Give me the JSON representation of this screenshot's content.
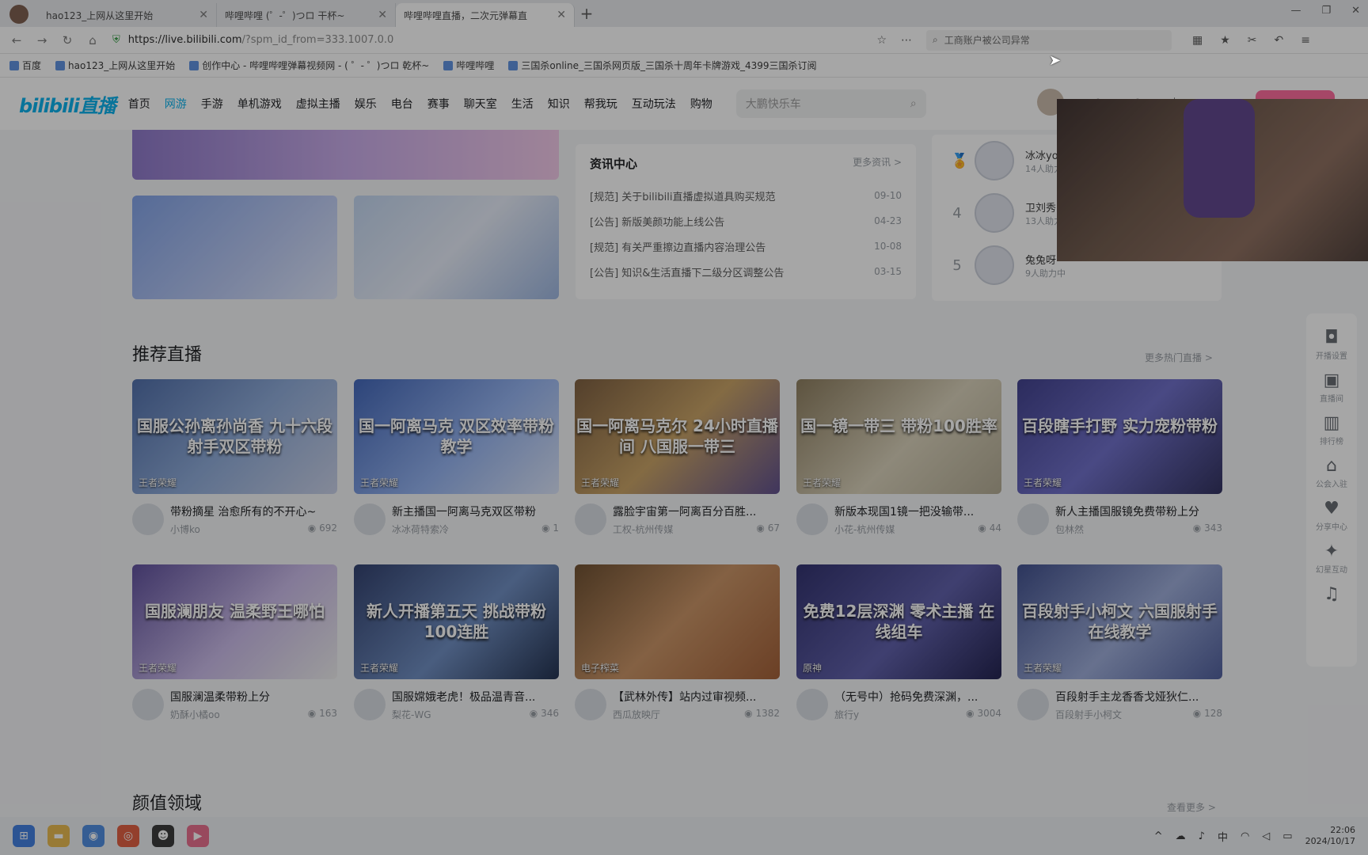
{
  "browser": {
    "tabs": [
      {
        "title": "hao123_上网从这里开始"
      },
      {
        "title": "哔哩哔哩 (゜-゜)つロ 干杯~"
      },
      {
        "title": "哔哩哔哩直播，二次元弹幕直"
      }
    ],
    "new_tab": "+",
    "url_host": "https://live.bilibili.com",
    "url_path": "/?spm_id_from=333.1007.0.0",
    "search_placeholder": "工商账户被公司异常",
    "bookmarks": [
      "百度",
      "hao123_上网从这里开始",
      "创作中心 - 哔哩哔哩弹幕视频网 - ( ゜- ゜)つロ 乾杯~",
      "哔哩哔哩",
      "三国杀online_三国杀网页版_三国杀十周年卡牌游戏_4399三国杀订阅"
    ]
  },
  "site": {
    "logo": "bilibili直播",
    "nav": [
      "首页",
      "网游",
      "手游",
      "单机游戏",
      "虚拟主播",
      "娱乐",
      "电台",
      "赛事",
      "聊天室",
      "生活",
      "知识",
      "帮我玩",
      "互动玩法",
      "购物"
    ],
    "search_placeholder": "大鹏快乐车"
  },
  "news": {
    "title": "资讯中心",
    "more": "更多资讯 >",
    "items": [
      {
        "text": "[规范] 关于bilibili直播虚拟道具购买规范",
        "date": "09-10"
      },
      {
        "text": "[公告] 新版美颜功能上线公告",
        "date": "04-23"
      },
      {
        "text": "[规范] 有关严重擦边直播内容治理公告",
        "date": "10-08"
      },
      {
        "text": "[公告] 知识&生活直播下二级分区调整公告",
        "date": "03-15"
      }
    ]
  },
  "rank": [
    {
      "num": "",
      "name": "冰冰yo",
      "sub": "14人助力"
    },
    {
      "num": "4",
      "name": "卫刘秀",
      "sub": "13人助力"
    },
    {
      "num": "5",
      "name": "兔兔呀",
      "sub": "9人助力中"
    }
  ],
  "recommend": {
    "title": "推荐直播",
    "more": "更多热门直播 >",
    "cards": [
      {
        "cap": "国服公孙离孙尚香 九十六段射手双区带粉",
        "cat": "王者荣耀",
        "title": "带粉摘星 治愈所有的不开心~",
        "user": "小博ko",
        "views": "692"
      },
      {
        "cap": "国一阿离马克 双区效率带粉 教学",
        "cat": "王者荣耀",
        "title": "新主播国一阿离马克双区带粉",
        "user": "冰冰荷特索冷",
        "views": "1"
      },
      {
        "cap": "国一阿离马克尔 24小时直播间 八国服一带三",
        "cat": "王者荣耀",
        "title": "露脸宇宙第一阿离百分百胜...",
        "user": "工权-杭州传媒",
        "views": "67"
      },
      {
        "cap": "国一镜一带三 带粉100胜率",
        "cat": "王者荣耀",
        "title": "新版本现国1镜一把没输带...",
        "user": "小花-杭州传媒",
        "views": "44"
      },
      {
        "cap": "百段瞎手打野 实力宠粉带粉",
        "cat": "王者荣耀",
        "title": "新人主播国服镜免费带粉上分",
        "user": "包林然",
        "views": "343"
      },
      {
        "cap": "国服澜朋友 温柔野王哪怕",
        "cat": "王者荣耀",
        "title": "国服澜温柔带粉上分",
        "user": "奶酥小橘oo",
        "views": "163"
      },
      {
        "cap": "新人开播第五天 挑战带粉100连胜",
        "cat": "王者荣耀",
        "title": "国服嫦娥老虎！极品温青音...",
        "user": "梨花-WG",
        "views": "346"
      },
      {
        "cap": "",
        "cat": "电子榨菜",
        "title": "【武林外传】站内过审视频...",
        "user": "西瓜放映厅",
        "views": "1382"
      },
      {
        "cap": "免费12层深渊 零术主播 在线组车",
        "cat": "原神",
        "title": "（无号中）抢码免费深渊，...",
        "user": "旅行y",
        "views": "3004"
      },
      {
        "cap": "百段射手小柯文 六国服射手在线教学",
        "cat": "王者荣耀",
        "title": "百段射手主龙香香戈娅狄仁...",
        "user": "百段射手小柯文",
        "views": "128"
      }
    ]
  },
  "yanzhi": {
    "title": "颜值领域",
    "more": "查看更多 >"
  },
  "sidebar": [
    {
      "icon": "camera-icon",
      "label": "开播设置"
    },
    {
      "icon": "tv-icon",
      "label": "直播间"
    },
    {
      "icon": "chart-icon",
      "label": "排行榜"
    },
    {
      "icon": "home-icon",
      "label": "公会入驻"
    },
    {
      "icon": "heart-icon",
      "label": "分享中心"
    },
    {
      "icon": "sparkle-icon",
      "label": "幻星互动"
    },
    {
      "icon": "bell-icon",
      "label": ""
    }
  ],
  "taskbar": {
    "ime": "中",
    "time": "22:06",
    "date": "2024/10/17"
  }
}
